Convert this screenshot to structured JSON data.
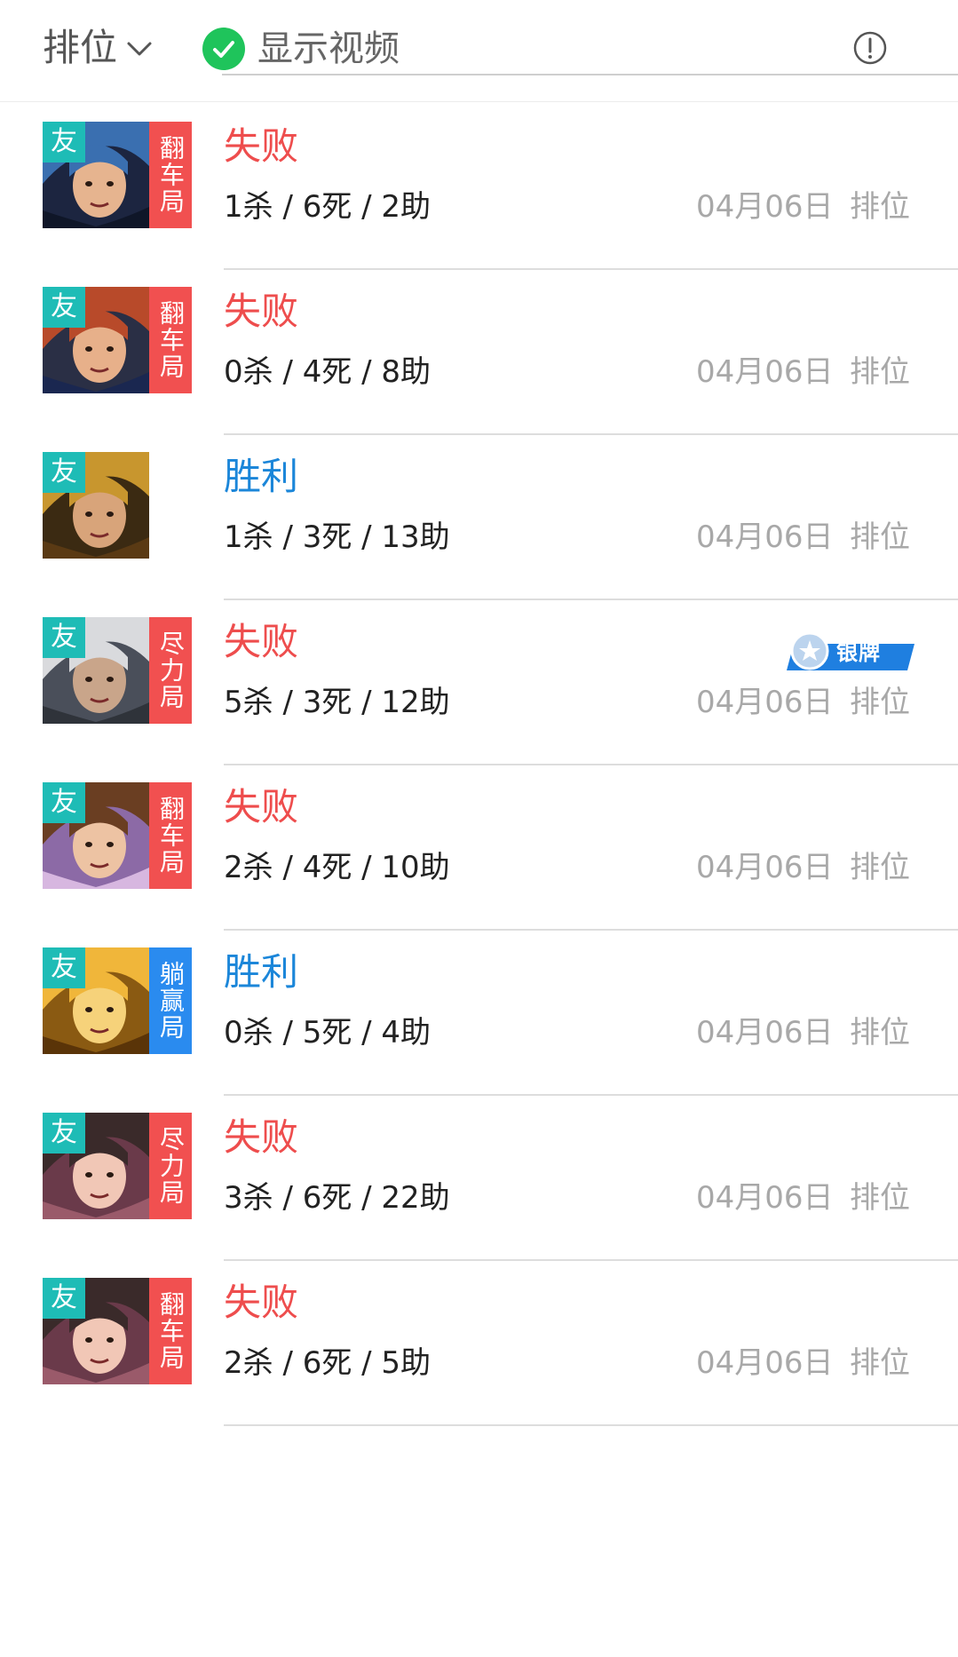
{
  "header": {
    "filter_label": "排位",
    "video_toggle_label": "显示视频",
    "video_toggle_checked": true
  },
  "colors": {
    "lose": "#ee4d4d",
    "win": "#1b86d9",
    "friend_tag": "#1ebcb6",
    "tag_red": "#f15050",
    "tag_blue": "#2a8bef",
    "check_green": "#1fc45b",
    "muted_text": "#a8a8a8"
  },
  "matches": [
    {
      "hero_icon": "hero-portrait-blue-haired",
      "friend_tag": "友",
      "side_tag": "翻车局",
      "side_tag_color": "red",
      "result": "失败",
      "result_type": "lose",
      "kda": "1杀 / 6死 / 2助",
      "date": "04月06日",
      "mode": "排位",
      "medal": null
    },
    {
      "hero_icon": "hero-portrait-warrior-fire",
      "friend_tag": "友",
      "side_tag": "翻车局",
      "side_tag_color": "red",
      "result": "失败",
      "result_type": "lose",
      "kda": "0杀 / 4死 / 8助",
      "date": "04月06日",
      "mode": "排位",
      "medal": null
    },
    {
      "hero_icon": "hero-portrait-golden-armor",
      "friend_tag": "友",
      "side_tag": "",
      "side_tag_color": "",
      "result": "胜利",
      "result_type": "win",
      "kda": "1杀 / 3死 / 13助",
      "date": "04月06日",
      "mode": "排位",
      "medal": null
    },
    {
      "hero_icon": "hero-portrait-white-beard",
      "friend_tag": "友",
      "side_tag": "尽力局",
      "side_tag_color": "red",
      "result": "失败",
      "result_type": "lose",
      "kda": "5杀 / 3死 / 12助",
      "date": "04月06日",
      "mode": "排位",
      "medal": "银牌"
    },
    {
      "hero_icon": "hero-portrait-brown-hair",
      "friend_tag": "友",
      "side_tag": "翻车局",
      "side_tag_color": "red",
      "result": "失败",
      "result_type": "lose",
      "kda": "2杀 / 4死 / 10助",
      "date": "04月06日",
      "mode": "排位",
      "medal": null
    },
    {
      "hero_icon": "hero-portrait-golden-knight",
      "friend_tag": "友",
      "side_tag": "躺赢局",
      "side_tag_color": "blue",
      "result": "胜利",
      "result_type": "win",
      "kda": "0杀 / 5死 / 4助",
      "date": "04月06日",
      "mode": "排位",
      "medal": null
    },
    {
      "hero_icon": "hero-portrait-flower-girl",
      "friend_tag": "友",
      "side_tag": "尽力局",
      "side_tag_color": "red",
      "result": "失败",
      "result_type": "lose",
      "kda": "3杀 / 6死 / 22助",
      "date": "04月06日",
      "mode": "排位",
      "medal": null
    },
    {
      "hero_icon": "hero-portrait-flower-girl",
      "friend_tag": "友",
      "side_tag": "翻车局",
      "side_tag_color": "red",
      "result": "失败",
      "result_type": "lose",
      "kda": "2杀 / 6死 / 5助",
      "date": "04月06日",
      "mode": "排位",
      "medal": null
    }
  ]
}
